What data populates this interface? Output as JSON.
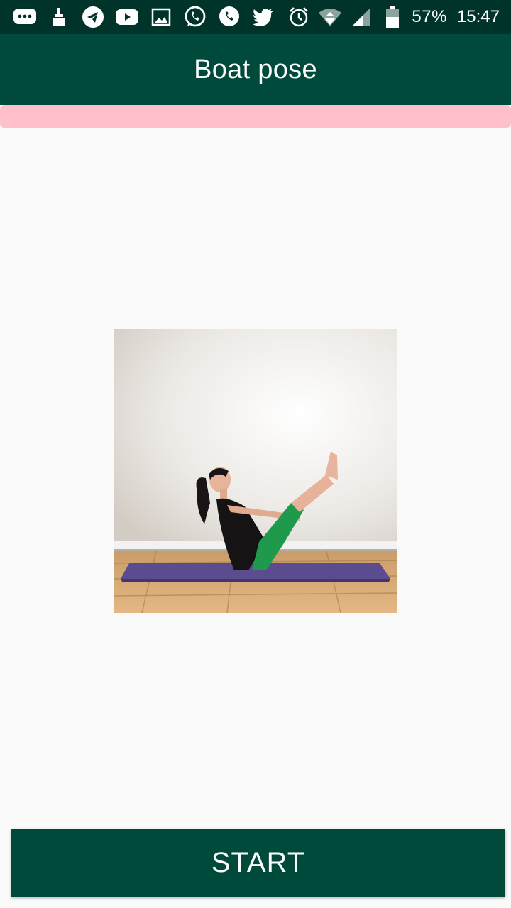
{
  "status_bar": {
    "icons": [
      "chat-bubble-icon",
      "broom-icon",
      "telegram-icon",
      "youtube-icon",
      "image-icon",
      "whatsapp-icon",
      "whatsapp-icon",
      "twitter-icon",
      "alarm-icon",
      "wifi-icon",
      "signal-icon",
      "battery-icon"
    ],
    "battery_percent": "57%",
    "time": "15:47"
  },
  "app_bar": {
    "title": "Boat pose"
  },
  "image": {
    "subject": "woman-in-boat-pose-on-purple-mat"
  },
  "actions": {
    "start_label": "START"
  },
  "colors": {
    "status_bar": "#00332a",
    "app_bar": "#004a3c",
    "progress_bar": "#ffc0cb",
    "background": "#fafafa",
    "button": "#004a3c"
  }
}
